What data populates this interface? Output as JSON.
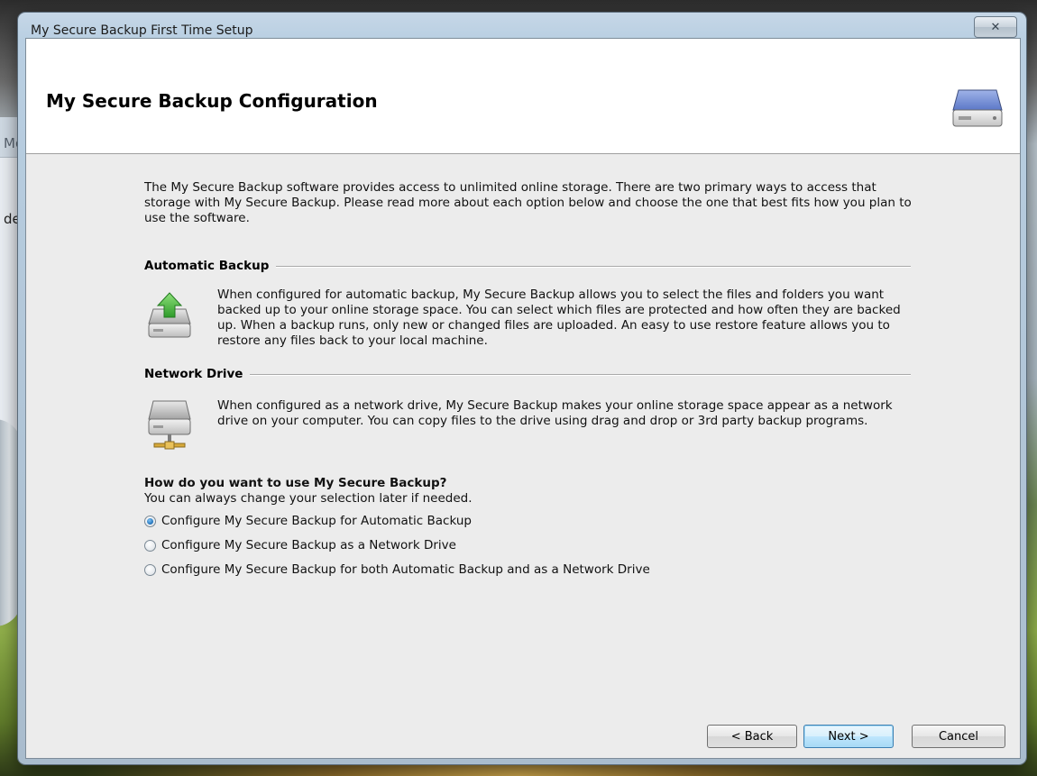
{
  "background": {
    "partial_text_top": "Mo",
    "partial_text_bottom": "de"
  },
  "window": {
    "title": "My Secure Backup First Time Setup",
    "close_glyph": "✕"
  },
  "header": {
    "title": "My Secure Backup Configuration",
    "icon": "hard-drive-icon"
  },
  "intro": "The My Secure Backup software provides access to unlimited online storage. There are two primary ways to access that storage with My Secure Backup. Please read more about each option below and choose the one that best fits how you plan to use the software.",
  "sections": {
    "automatic": {
      "heading": "Automatic Backup",
      "icon": "backup-drive-upload-icon",
      "text": "When configured for automatic backup, My Secure Backup allows you to select the files and folders you want backed up to your online storage space. You can select which files are protected and how often they are backed up. When a backup runs, only new or changed files are uploaded. An easy to use restore feature allows you to restore any files back to your local machine."
    },
    "network": {
      "heading": "Network Drive",
      "icon": "network-drive-icon",
      "text": "When configured as a network drive, My Secure Backup makes your online storage space appear as a network drive on your computer. You can copy files to the drive using drag and drop or 3rd party backup programs."
    }
  },
  "question": {
    "title": "How do you want to use My Secure Backup?",
    "subtitle": "You can always change your selection later if needed.",
    "options": [
      {
        "label": "Configure My Secure Backup for Automatic Backup",
        "selected": true
      },
      {
        "label": "Configure My Secure Backup as a Network Drive",
        "selected": false
      },
      {
        "label": "Configure My Secure Backup for both Automatic Backup and as a Network Drive",
        "selected": false
      }
    ]
  },
  "buttons": {
    "back": "< Back",
    "next": "Next >",
    "cancel": "Cancel"
  },
  "colors": {
    "accent": "#3c7fb1",
    "client_bg": "#ececec",
    "radio_selected": "#1f6fb8"
  }
}
